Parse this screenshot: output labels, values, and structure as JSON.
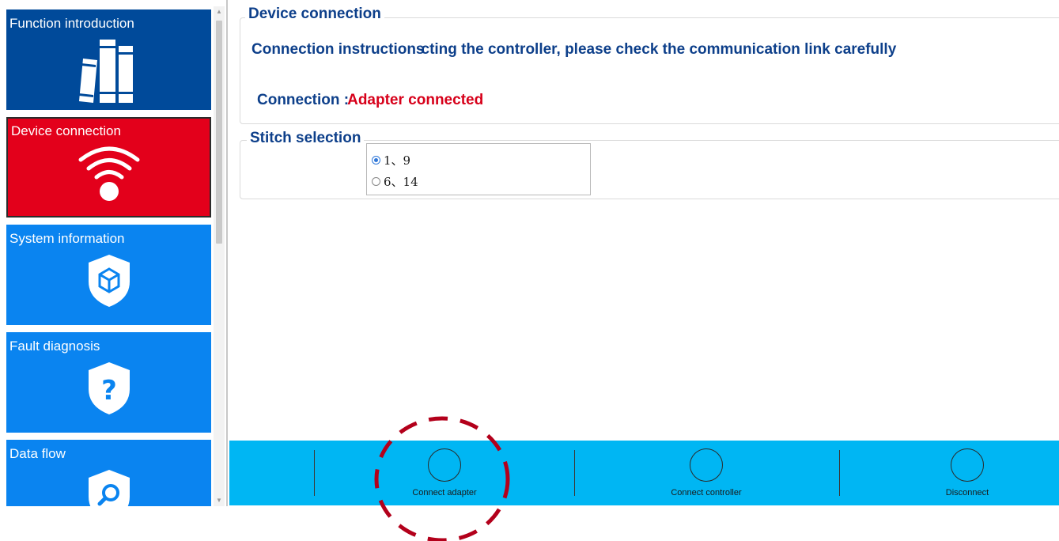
{
  "sidebar": {
    "items": [
      {
        "label": "Function introduction",
        "icon": "books-icon",
        "color": "#004a9a"
      },
      {
        "label": "Device connection",
        "icon": "wifi-icon",
        "color": "#e3001b"
      },
      {
        "label": "System information",
        "icon": "shield-cube-icon",
        "color": "#0a84f0"
      },
      {
        "label": "Fault diagnosis",
        "icon": "shield-question-icon",
        "color": "#0a84f0"
      },
      {
        "label": "Data flow",
        "icon": "shield-search-icon",
        "color": "#0a84f0"
      }
    ]
  },
  "device_group": {
    "title": "Device connection",
    "instructions_label": "Connection instructions",
    "instructions_text": "cting the controller, please check the communication link carefully",
    "connection_label": "Connection :",
    "connection_value": "Adapter connected"
  },
  "stitch_group": {
    "title": "Stitch selection",
    "options": [
      {
        "label": "1、9",
        "selected": true
      },
      {
        "label": "6、14",
        "selected": false
      }
    ]
  },
  "bottom_bar": {
    "buttons": [
      {
        "label": "Connect adapter"
      },
      {
        "label": "Connect controller"
      },
      {
        "label": "Disconnect"
      }
    ]
  },
  "colors": {
    "accent_blue": "#0d3f8a",
    "status_red": "#d7001a",
    "bar_blue": "#00b6f3",
    "annotation_red": "#b3001b"
  }
}
